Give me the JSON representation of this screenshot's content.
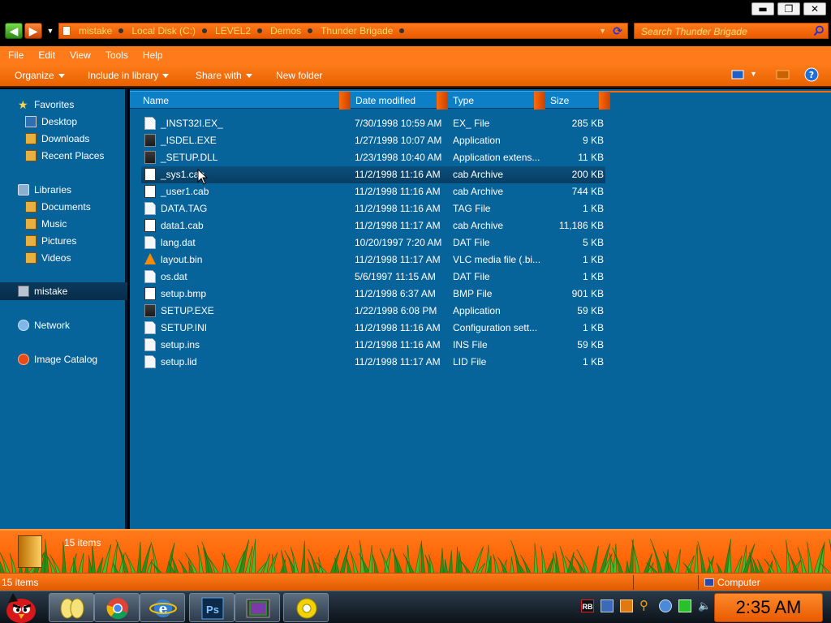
{
  "window": {
    "minimize_glyph": "▬",
    "maximize_glyph": "❐",
    "close_glyph": "✕"
  },
  "address": {
    "back_icon": "green-left-arrow",
    "forward_icon": "orange-right-arrow",
    "breadcrumbs": [
      "mistake",
      "Local Disk (C:)",
      "LEVEL2",
      "Demos",
      "Thunder Brigade"
    ],
    "search_placeholder": "Search Thunder Brigade"
  },
  "menu": {
    "items": [
      "File",
      "Edit",
      "View",
      "Tools",
      "Help"
    ]
  },
  "toolbar": {
    "organize": "Organize",
    "include_in_library": "Include in library",
    "share_with": "Share with",
    "new_folder": "New folder"
  },
  "nav": {
    "favorites": "Favorites",
    "desktop": "Desktop",
    "downloads": "Downloads",
    "recent_places": "Recent Places",
    "libraries": "Libraries",
    "documents": "Documents",
    "music": "Music",
    "pictures": "Pictures",
    "videos": "Videos",
    "homegroup": "mistake",
    "network": "Network",
    "image_catalog": "Image Catalog"
  },
  "columns": {
    "name": "Name",
    "date_modified": "Date modified",
    "type": "Type",
    "size": "Size"
  },
  "files": [
    {
      "name": "_INST32I.EX_",
      "date": "7/30/1998 10:59 AM",
      "type": "EX_ File",
      "size": "285 KB",
      "icon": "doc"
    },
    {
      "name": "_ISDEL.EXE",
      "date": "1/27/1998 10:07 AM",
      "type": "Application",
      "size": "9 KB",
      "icon": "exe"
    },
    {
      "name": "_SETUP.DLL",
      "date": "1/23/1998 10:40 AM",
      "type": "Application extens...",
      "size": "11 KB",
      "icon": "exe"
    },
    {
      "name": "_sys1.cab",
      "date": "11/2/1998 11:16 AM",
      "type": "cab Archive",
      "size": "200 KB",
      "icon": "cab"
    },
    {
      "name": "_user1.cab",
      "date": "11/2/1998 11:16 AM",
      "type": "cab Archive",
      "size": "744 KB",
      "icon": "cab"
    },
    {
      "name": "DATA.TAG",
      "date": "11/2/1998 11:16 AM",
      "type": "TAG File",
      "size": "1 KB",
      "icon": "doc"
    },
    {
      "name": "data1.cab",
      "date": "11/2/1998 11:17 AM",
      "type": "cab Archive",
      "size": "11,186 KB",
      "icon": "cab"
    },
    {
      "name": "lang.dat",
      "date": "10/20/1997 7:20 AM",
      "type": "DAT File",
      "size": "5 KB",
      "icon": "doc"
    },
    {
      "name": "layout.bin",
      "date": "11/2/1998 11:17 AM",
      "type": "VLC media file (.bi...",
      "size": "1 KB",
      "icon": "vlc"
    },
    {
      "name": "os.dat",
      "date": "5/6/1997 11:15 AM",
      "type": "DAT File",
      "size": "1 KB",
      "icon": "doc"
    },
    {
      "name": "setup.bmp",
      "date": "11/2/1998 6:37 AM",
      "type": "BMP File",
      "size": "901 KB",
      "icon": "bmp"
    },
    {
      "name": "SETUP.EXE",
      "date": "1/22/1998 6:08 PM",
      "type": "Application",
      "size": "59 KB",
      "icon": "exe"
    },
    {
      "name": "SETUP.INI",
      "date": "11/2/1998 11:16 AM",
      "type": "Configuration sett...",
      "size": "1 KB",
      "icon": "ini"
    },
    {
      "name": "setup.ins",
      "date": "11/2/1998 11:16 AM",
      "type": "INS File",
      "size": "59 KB",
      "icon": "doc"
    },
    {
      "name": "setup.lid",
      "date": "11/2/1998 11:17 AM",
      "type": "LID File",
      "size": "1 KB",
      "icon": "doc"
    }
  ],
  "details": {
    "count": "15 items"
  },
  "status": {
    "items": "15 items",
    "zone": "Computer"
  },
  "taskbar": {
    "clock": "2:35 AM",
    "tray_rb": "RB"
  },
  "colors": {
    "accent_orange": "#ff7a1a",
    "pane_blue": "#06649b",
    "header_blue": "#0c7fc6"
  }
}
